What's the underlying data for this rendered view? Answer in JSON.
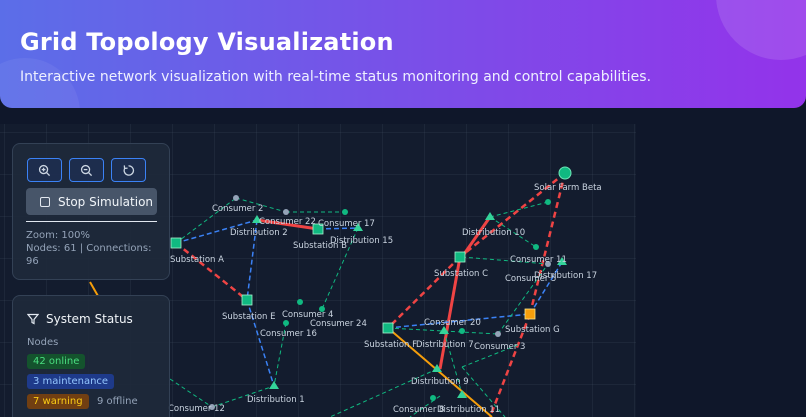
{
  "header": {
    "title": "Grid Topology Visualization",
    "subtitle": "Interactive network visualization with real-time status monitoring and control capabilities."
  },
  "controls": {
    "zoom_in_icon": "zoom-in-icon",
    "zoom_out_icon": "zoom-out-icon",
    "reset_icon": "reset-icon",
    "simulation_label": "Stop Simulation",
    "zoom_text": "Zoom: 100%",
    "nodes_text": "Nodes: 61 | Connections: 96"
  },
  "status": {
    "title": "System Status",
    "nodes_label": "Nodes",
    "online": "42 online",
    "maintenance": "3 maintenance",
    "warning": "7 warning",
    "offline": "9 offline"
  },
  "colors": {
    "online": "#22c55e",
    "maintenance": "#3b82f6",
    "warning": "#eab308",
    "critical": "#ef4444",
    "node_fill": "#10b981",
    "node_alert": "#f59e0b"
  },
  "network": {
    "labels": [
      {
        "text": "Solar Farm Beta"
      },
      {
        "text": "Consumer 2"
      },
      {
        "text": "Consumer 22"
      },
      {
        "text": "Consumer 17"
      },
      {
        "text": "Distribution 2"
      },
      {
        "text": "Substation B"
      },
      {
        "text": "Distribution 15"
      },
      {
        "text": "Distribution 10"
      },
      {
        "text": "Consumer 11"
      },
      {
        "text": "Consumer 5"
      },
      {
        "text": "Distribution 17"
      },
      {
        "text": "Substation C"
      },
      {
        "text": "Substation A"
      },
      {
        "text": "Consumer 4"
      },
      {
        "text": "Substation E"
      },
      {
        "text": "Consumer 24"
      },
      {
        "text": "Consumer 16"
      },
      {
        "text": "Consumer 20"
      },
      {
        "text": "Substation G"
      },
      {
        "text": "Substation F"
      },
      {
        "text": "Distribution 7"
      },
      {
        "text": "Consumer 3"
      },
      {
        "text": "Distribution 9"
      },
      {
        "text": "Distribution 1"
      },
      {
        "text": "Consumer 8"
      },
      {
        "text": "Distribution 11"
      },
      {
        "text": "Consumer 12"
      }
    ]
  }
}
